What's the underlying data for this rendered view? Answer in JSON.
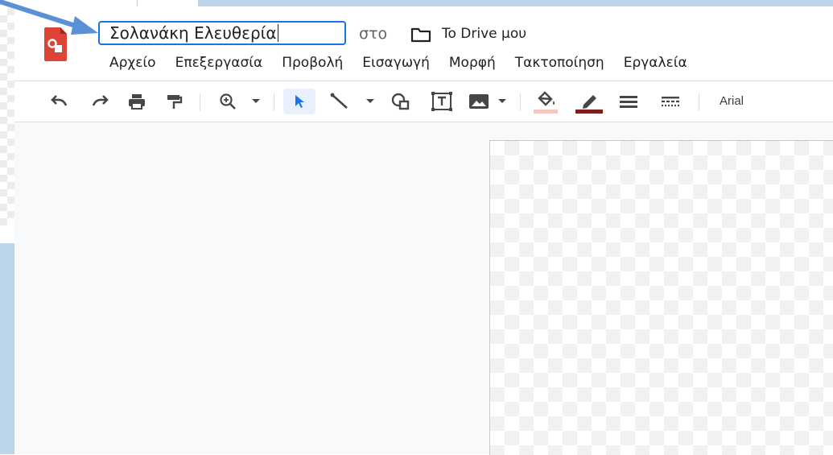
{
  "app": {
    "document_title": "Σολανάκη Ελευθερία",
    "location_prefix": "στο",
    "location_folder": "To Drive μου"
  },
  "menu": [
    "Αρχείο",
    "Επεξεργασία",
    "Προβολή",
    "Εισαγωγή",
    "Μορφή",
    "Τακτοποίηση",
    "Εργαλεία"
  ],
  "toolbar": {
    "icons": [
      "undo-icon",
      "redo-icon",
      "print-icon",
      "paint-format-icon",
      "zoom-icon",
      "select-arrow-icon",
      "line-icon",
      "shape-icon",
      "text-box-icon",
      "image-icon",
      "fill-color-icon",
      "border-color-icon",
      "border-weight-icon",
      "border-dash-icon"
    ],
    "font": "Arial"
  },
  "colors": {
    "accent": "#1a73e8",
    "logo": "#db4437",
    "fill_swatch": "#f4c7c3",
    "border_swatch": "#7f1d1d",
    "frame_blue": "#bcd4ea",
    "annotation_arrow": "#5b8fd6"
  }
}
